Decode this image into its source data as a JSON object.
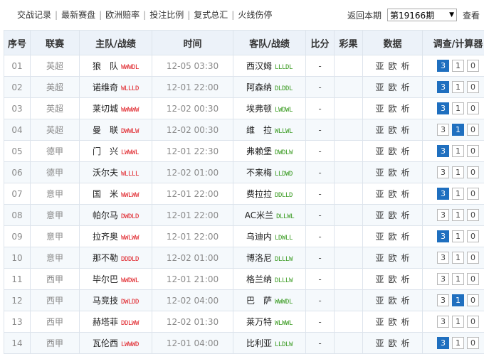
{
  "topnav": {
    "links": [
      "交战记录",
      "最新赛盘",
      "欧洲赔率",
      "投注比例",
      "复式总汇",
      "火线伤停"
    ],
    "back_label": "返回本期",
    "period_value": "第19166期",
    "view_label": "查看"
  },
  "table": {
    "headers": [
      "序号",
      "联赛",
      "主队/战绩",
      "时间",
      "客队/战绩",
      "比分",
      "彩果",
      "数据",
      "调查/计算器"
    ],
    "data_links": [
      "亚",
      "欧",
      "析"
    ],
    "rows": [
      {
        "idx": "01",
        "league": "英超",
        "home": "狼　队",
        "home_form": "WWWDL",
        "time": "12-05 03:30",
        "away": "西汉姆",
        "away_form": "LLLDL",
        "score": "-",
        "result": "",
        "calc": [
          "3",
          "1",
          "0"
        ],
        "selected": 0
      },
      {
        "idx": "02",
        "league": "英超",
        "home": "诺维奇",
        "home_form": "WLLLD",
        "time": "12-01 22:00",
        "away": "阿森纳",
        "away_form": "DLDDL",
        "score": "-",
        "result": "",
        "calc": [
          "3",
          "1",
          "0"
        ],
        "selected": 0
      },
      {
        "idx": "03",
        "league": "英超",
        "home": "莱切城",
        "home_form": "WWWWW",
        "time": "12-02 00:30",
        "away": "埃弗顿",
        "away_form": "LWDWL",
        "score": "-",
        "result": "",
        "calc": [
          "3",
          "1",
          "0"
        ],
        "selected": 0
      },
      {
        "idx": "04",
        "league": "英超",
        "home": "曼　联",
        "home_form": "DWWLW",
        "time": "12-02 00:30",
        "away": "维　拉",
        "away_form": "WLLWL",
        "score": "-",
        "result": "",
        "calc": [
          "3",
          "1",
          "0"
        ],
        "selected": 1
      },
      {
        "idx": "05",
        "league": "德甲",
        "home": "门　兴",
        "home_form": "LWWWL",
        "time": "12-01 22:30",
        "away": "弗赖堡",
        "away_form": "DWDLW",
        "score": "-",
        "result": "",
        "calc": [
          "3",
          "1",
          "0"
        ],
        "selected": 0
      },
      {
        "idx": "06",
        "league": "德甲",
        "home": "沃尔夫",
        "home_form": "WLLLL",
        "time": "12-02 01:00",
        "away": "不来梅",
        "away_form": "LLDWD",
        "score": "-",
        "result": "",
        "calc": [
          "3",
          "1",
          "0"
        ],
        "selected": -1
      },
      {
        "idx": "07",
        "league": "意甲",
        "home": "国　米",
        "home_form": "WWLWW",
        "time": "12-01 22:00",
        "away": "费拉拉",
        "away_form": "DDLLD",
        "score": "-",
        "result": "",
        "calc": [
          "3",
          "1",
          "0"
        ],
        "selected": 0
      },
      {
        "idx": "08",
        "league": "意甲",
        "home": "帕尔马",
        "home_form": "DWDLD",
        "time": "12-01 22:00",
        "away": "AC米兰",
        "away_form": "DLLWL",
        "score": "-",
        "result": "",
        "calc": [
          "3",
          "1",
          "0"
        ],
        "selected": -1
      },
      {
        "idx": "09",
        "league": "意甲",
        "home": "拉齐奥",
        "home_form": "WWLWW",
        "time": "12-01 22:00",
        "away": "乌迪内",
        "away_form": "LDWLL",
        "score": "-",
        "result": "",
        "calc": [
          "3",
          "1",
          "0"
        ],
        "selected": 0
      },
      {
        "idx": "10",
        "league": "意甲",
        "home": "那不勒",
        "home_form": "DDDLD",
        "time": "12-02 01:00",
        "away": "博洛尼",
        "away_form": "DLLLW",
        "score": "-",
        "result": "",
        "calc": [
          "3",
          "1",
          "0"
        ],
        "selected": -1
      },
      {
        "idx": "11",
        "league": "西甲",
        "home": "毕尔巴",
        "home_form": "WWDWL",
        "time": "12-01 21:00",
        "away": "格兰纳",
        "away_form": "DLLLW",
        "score": "-",
        "result": "",
        "calc": [
          "3",
          "1",
          "0"
        ],
        "selected": -1
      },
      {
        "idx": "12",
        "league": "西甲",
        "home": "马竞技",
        "home_form": "DWLDD",
        "time": "12-02 04:00",
        "away": "巴　萨",
        "away_form": "WWWDL",
        "score": "-",
        "result": "",
        "calc": [
          "3",
          "1",
          "0"
        ],
        "selected": 1
      },
      {
        "idx": "13",
        "league": "西甲",
        "home": "赫塔菲",
        "home_form": "DDLWW",
        "time": "12-02 01:30",
        "away": "莱万特",
        "away_form": "WLWWL",
        "score": "-",
        "result": "",
        "calc": [
          "3",
          "1",
          "0"
        ],
        "selected": -1
      },
      {
        "idx": "14",
        "league": "西甲",
        "home": "瓦伦西",
        "home_form": "LWWWD",
        "time": "12-01 04:00",
        "away": "比利亚",
        "away_form": "LLDLW",
        "score": "-",
        "result": "",
        "calc": [
          "3",
          "1",
          "0"
        ],
        "selected": 0
      }
    ]
  },
  "colors": {
    "header_bg": "#ecf2f9",
    "border": "#dde4ec",
    "alt_row": "#f5f9fc",
    "selected_button": "#1f6fbf",
    "home_form": "#e0242a",
    "away_form": "#3c9c24"
  },
  "icons": {
    "period_dropdown": "chevron-down-icon"
  }
}
